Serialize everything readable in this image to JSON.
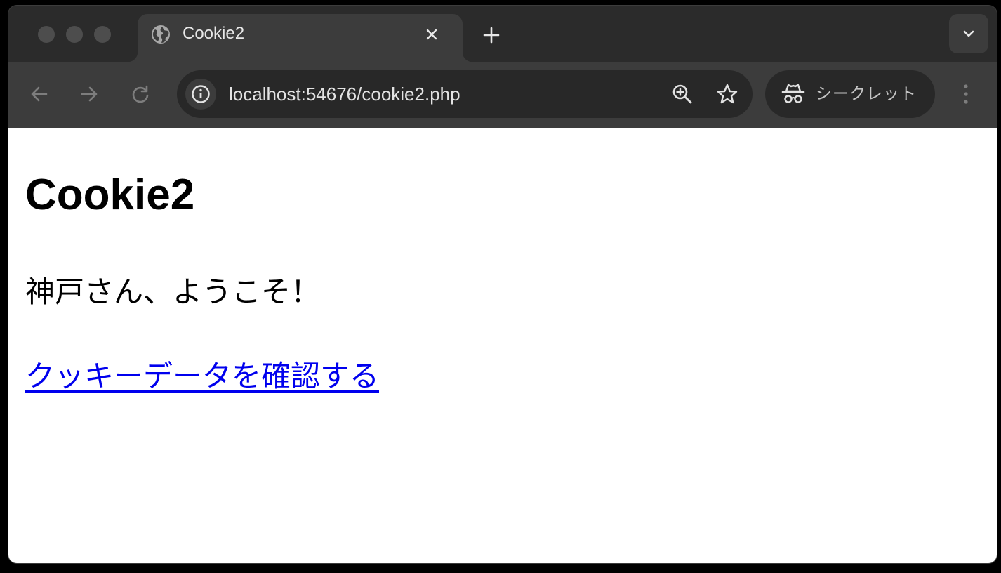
{
  "browser": {
    "window_controls": [
      "close",
      "minimize",
      "maximize"
    ],
    "tab": {
      "title": "Cookie2",
      "favicon": "globe-icon",
      "close_icon": "close-icon"
    },
    "new_tab_icon": "plus-icon",
    "tab_search_icon": "chevron-down-icon",
    "toolbar": {
      "back_icon": "arrow-left-icon",
      "forward_icon": "arrow-right-icon",
      "reload_icon": "reload-icon",
      "site_info_icon": "info-icon",
      "url": "localhost:54676/cookie2.php",
      "zoom_icon": "zoom-in-icon",
      "bookmark_icon": "star-icon",
      "incognito_icon": "incognito-icon",
      "incognito_label": "シークレット",
      "menu_icon": "kebab-menu-icon"
    },
    "colors": {
      "frame": "#2b2b2b",
      "toolbar": "#3c3c3c",
      "omnibox": "#282828",
      "link": "#0000ee"
    }
  },
  "page": {
    "heading": "Cookie2",
    "welcome_message": "神戸さん、ようこそ！",
    "link_text": "クッキーデータを確認する"
  }
}
